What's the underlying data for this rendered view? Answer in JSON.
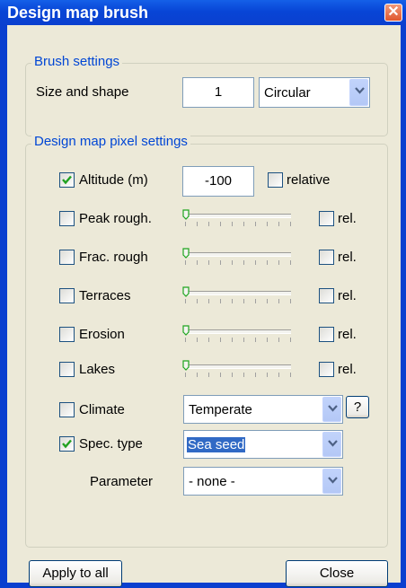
{
  "window": {
    "title": "Design map brush"
  },
  "brush_settings": {
    "group_label": "Brush settings",
    "size_label": "Size and shape",
    "size_value": "1",
    "shape_value": "Circular"
  },
  "pixel_settings": {
    "group_label": "Design map pixel settings",
    "altitude": {
      "label": "Altitude (m)",
      "checked": true,
      "value": "-100",
      "relative_label": "relative",
      "relative_checked": false
    },
    "sliders": [
      {
        "label": "Peak rough.",
        "checked": false,
        "level": 0,
        "rel_label": "rel.",
        "rel_checked": false
      },
      {
        "label": "Frac. rough",
        "checked": false,
        "level": 0,
        "rel_label": "rel.",
        "rel_checked": false
      },
      {
        "label": "Terraces",
        "checked": false,
        "level": 0,
        "rel_label": "rel.",
        "rel_checked": false
      },
      {
        "label": "Erosion",
        "checked": false,
        "level": 0,
        "rel_label": "rel.",
        "rel_checked": false
      },
      {
        "label": "Lakes",
        "checked": false,
        "level": 0,
        "rel_label": "rel.",
        "rel_checked": false
      }
    ],
    "climate": {
      "label": "Climate",
      "checked": false,
      "value": "Temperate",
      "help_label": "?"
    },
    "spec_type": {
      "label": "Spec. type",
      "checked": true,
      "value": "Sea seed"
    },
    "parameter": {
      "label": "Parameter",
      "value": "- none -"
    }
  },
  "buttons": {
    "apply_all": "Apply to all",
    "close": "Close"
  },
  "icons": {
    "close": "close-icon",
    "check": "checkmark-icon",
    "dropdown": "chevron-down-icon"
  },
  "colors": {
    "title_bar": "#0a3fcf",
    "face": "#ece9d8",
    "group_label": "#0046d5",
    "selection": "#316ac5"
  }
}
